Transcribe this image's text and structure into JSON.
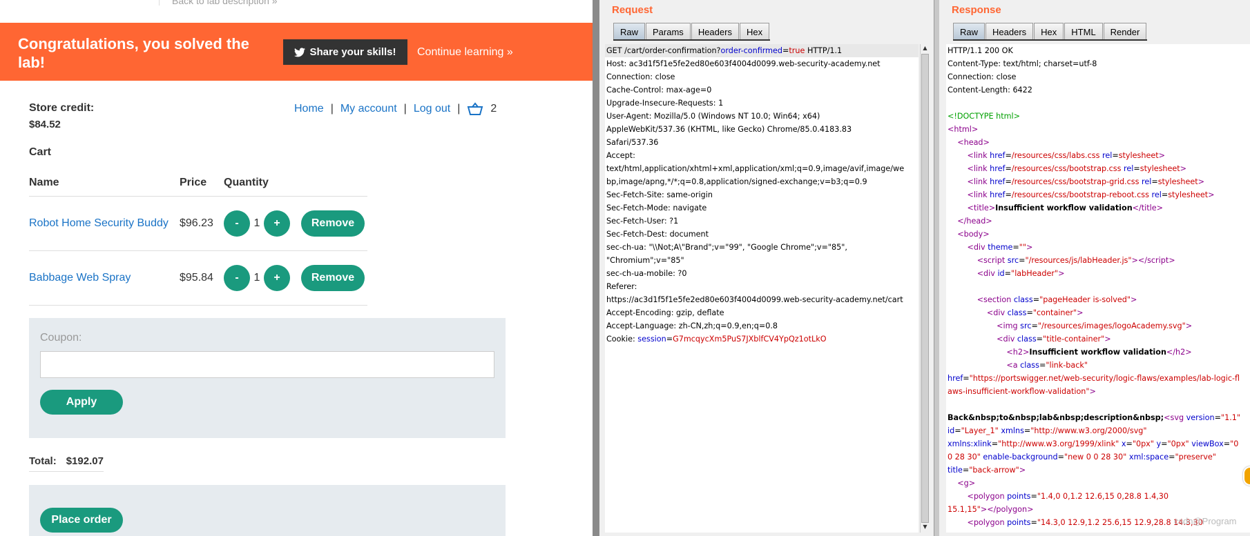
{
  "lab": {
    "back_link": "Back to lab description",
    "banner_title": "Congratulations, you solved the lab!",
    "share_label": "Share your skills!",
    "continue_label": "Continue learning",
    "credit_label": "Store credit:",
    "credit_value": "$84.52",
    "nav": {
      "home": "Home",
      "sep": "|",
      "account": "My account",
      "logout": "Log out",
      "cart_count": "2"
    },
    "cart_heading": "Cart",
    "columns": [
      "Name",
      "Price",
      "Quantity"
    ],
    "items": [
      {
        "name": "Robot Home Security Buddy",
        "price": "$96.23",
        "qty": "1"
      },
      {
        "name": "Babbage Web Spray",
        "price": "$95.84",
        "qty": "1"
      }
    ],
    "minus": "-",
    "plus": "+",
    "remove_label": "Remove",
    "coupon_label": "Coupon:",
    "apply_label": "Apply",
    "total_label": "Total:",
    "total_value": "$192.07",
    "place_order_label": "Place order"
  },
  "request": {
    "title": "Request",
    "tabs": [
      "Raw",
      "Params",
      "Headers",
      "Hex"
    ],
    "first_line": {
      "pre": "GET /cart/order-confirmation?",
      "key": "order-confirmed",
      "eq": "=",
      "val": "true",
      "post": " HTTP/1.1"
    },
    "lines": [
      "Host: ac3d1f5f1e5fe2ed80e603f4004d0099.web-security-academy.net",
      "Connection: close",
      "Cache-Control: max-age=0",
      "Upgrade-Insecure-Requests: 1",
      "User-Agent: Mozilla/5.0 (Windows NT 10.0; Win64; x64)",
      "AppleWebKit/537.36 (KHTML, like Gecko) Chrome/85.0.4183.83",
      "Safari/537.36",
      "Accept:",
      "text/html,application/xhtml+xml,application/xml;q=0.9,image/avif,image/we",
      "bp,image/apng,*/*;q=0.8,application/signed-exchange;v=b3;q=0.9",
      "Sec-Fetch-Site: same-origin",
      "Sec-Fetch-Mode: navigate",
      "Sec-Fetch-User: ?1",
      "Sec-Fetch-Dest: document",
      "sec-ch-ua: \"\\\\Not;A\\\"Brand\";v=\"99\", \"Google Chrome\";v=\"85\",",
      "\"Chromium\";v=\"85\"",
      "sec-ch-ua-mobile: ?0",
      "Referer:",
      "https://ac3d1f5f1e5fe2ed80e603f4004d0099.web-security-academy.net/cart",
      "Accept-Encoding: gzip, deflate",
      "Accept-Language: zh-CN,zh;q=0.9,en;q=0.8"
    ],
    "cookie": {
      "label": "Cookie: ",
      "key": "session",
      "eq": "=",
      "val": "G7mcqycXm5PuS7JXblfCV4YpQz1otLkO"
    }
  },
  "response": {
    "title": "Response",
    "tabs": [
      "Raw",
      "Headers",
      "Hex",
      "HTML",
      "Render"
    ],
    "headers": [
      "HTTP/1.1 200 OK",
      "Content-Type: text/html; charset=utf-8",
      "Connection: close",
      "Content-Length: 6422"
    ],
    "doctype": "<!DOCTYPE html>",
    "css1": "/resources/css/labs.css",
    "css2": "/resources/css/bootstrap.css",
    "css3": "/resources/css/bootstrap-grid.css",
    "css4": "/resources/css/bootstrap-reboot.css",
    "page_title": "Insufficient workflow validation",
    "script_src": "\"/resources/js/labHeader.js\"",
    "lab_header_id": "\"labHeader\"",
    "section_class": "\"pageHeader is-solved\"",
    "container_class": "\"container\"",
    "logo_src": "\"/resources/images/logoAcademy.svg\"",
    "title_container_class": "\"title-container\"",
    "h2_text": "Insufficient workflow validation",
    "link_back_class": "\"link-back\"",
    "href_url_1": "\"https://portswigger.net/web-security/logic-flaws/examples/lab-logic-fl",
    "href_url_2": "aws-insufficient-workflow-validation\"",
    "back_text": "Back&nbsp;to&nbsp;lab&nbsp;description&nbsp;",
    "watermark": "csdn@Program"
  }
}
